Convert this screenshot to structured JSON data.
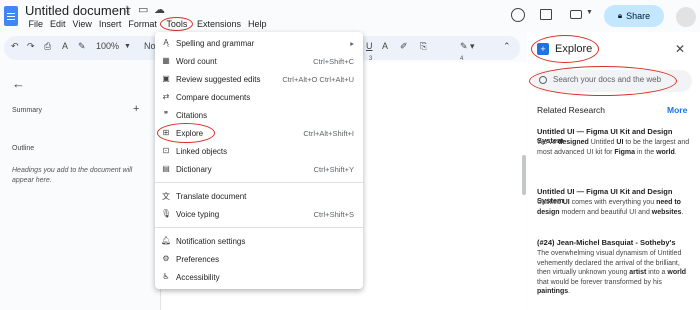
{
  "title_bar": {
    "doc_title": "Untitled document",
    "menus": [
      "File",
      "Edit",
      "View",
      "Insert",
      "Format",
      "Tools",
      "Extensions",
      "Help"
    ],
    "share_label": "Share"
  },
  "toolbar": {
    "zoom": "100%",
    "style_partial": "No"
  },
  "outline_panel": {
    "summary_label": "Summary",
    "outline_label": "Outline",
    "outline_hint": "Headings you add to the document will appear here."
  },
  "tools_menu": {
    "items": [
      {
        "label": "Spelling and grammar",
        "shortcut": "▸",
        "icon": "spell-check-icon"
      },
      {
        "label": "Word count",
        "shortcut": "Ctrl+Shift+C",
        "icon": "word-count-icon"
      },
      {
        "label": "Review suggested edits",
        "shortcut": "Ctrl+Alt+O Ctrl+Alt+U",
        "icon": "review-icon"
      },
      {
        "label": "Compare documents",
        "shortcut": "",
        "icon": "compare-icon"
      },
      {
        "label": "Citations",
        "shortcut": "",
        "icon": "citation-icon"
      },
      {
        "label": "Explore",
        "shortcut": "Ctrl+Alt+Shift+I",
        "icon": "explore-icon"
      },
      {
        "label": "Linked objects",
        "shortcut": "",
        "icon": "link-icon"
      },
      {
        "label": "Dictionary",
        "shortcut": "Ctrl+Shift+Y",
        "icon": "book-icon"
      },
      {
        "label": "Translate document",
        "shortcut": "",
        "icon": "translate-icon"
      },
      {
        "label": "Voice typing",
        "shortcut": "Ctrl+Shift+S",
        "icon": "mic-icon"
      },
      {
        "label": "Notification settings",
        "shortcut": "",
        "icon": "bell-icon"
      },
      {
        "label": "Preferences",
        "shortcut": "",
        "icon": "preferences-icon"
      },
      {
        "label": "Accessibility",
        "shortcut": "",
        "icon": "accessibility-icon"
      }
    ]
  },
  "explore": {
    "title": "Explore",
    "search_placeholder": "Search your docs and the web",
    "related_label": "Related Research",
    "more_label": "More",
    "results": [
      {
        "title": "Untitled UI — Figma UI Kit and Design System",
        "snippet_html": "We've <b>designed</b> Untitled <b>UI</b> to be the largest and most advanced UI kit for <b>Figma</b> in the <b>world</b>."
      },
      {
        "title": "Untitled UI — Figma UI Kit and Design System",
        "snippet_html": "Untitled <b>UI</b> comes with everything you <b>need to design</b> modern and beautiful UI and <b>websites</b>."
      },
      {
        "title": "(#24) Jean-Michel Basquiat - Sotheby's",
        "snippet_html": "The overwhelming visual dynamism of Untitled vehemently declared the arrival of the brilliant, then virtually unknown young <b>artist</b> into a <b>world</b> that would be forever transformed by his <b>paintings</b>."
      }
    ]
  },
  "colors": {
    "accent": "#1a73e8",
    "share_bg": "#c2e7ff",
    "highlight_circle": "#d93025"
  }
}
